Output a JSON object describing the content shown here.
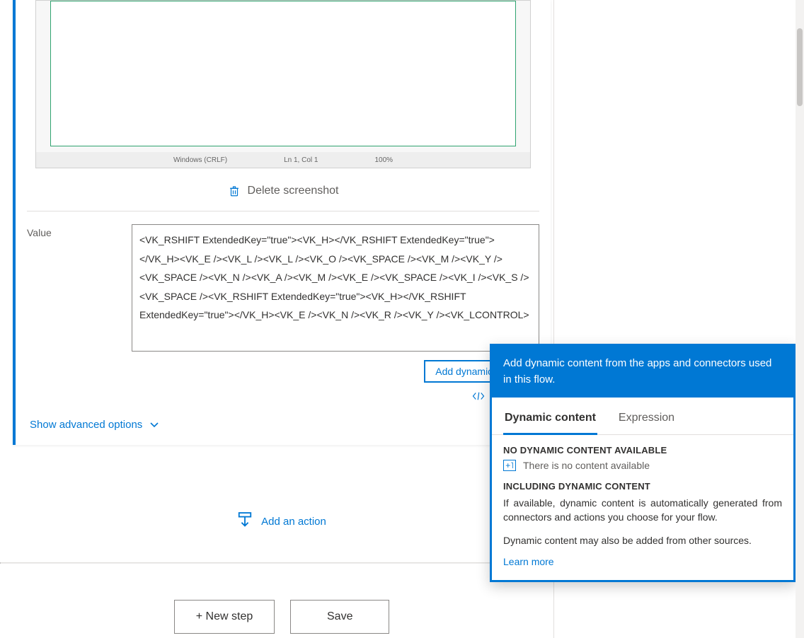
{
  "screenshot": {
    "statusbar_left": "Windows (CRLF)",
    "statusbar_mid": "Ln 1, Col 1",
    "statusbar_right": "100%"
  },
  "deleteScreenshotLabel": "Delete screenshot",
  "valueLabel": "Value",
  "valueText": "<VK_RSHIFT ExtendedKey=\"true\"><VK_H></VK_RSHIFT ExtendedKey=\"true\"></VK_H><VK_E /><VK_L /><VK_L /><VK_O /><VK_SPACE /><VK_M /><VK_Y /><VK_SPACE /><VK_N /><VK_A /><VK_M /><VK_E /><VK_SPACE /><VK_I /><VK_S /><VK_SPACE /><VK_RSHIFT ExtendedKey=\"true\"><VK_H></VK_RSHIFT ExtendedKey=\"true\"></VK_H><VK_E /><VK_N /><VK_R /><VK_Y /><VK_LCONTROL>",
  "addDynamicPill": "Add dynamic content",
  "editCodeLabel": "Edit code",
  "showAdvancedLabel": "Show advanced options",
  "addActionLabel": "Add an action",
  "footer": {
    "newStep": "+ New step",
    "save": "Save"
  },
  "popup": {
    "header": "Add dynamic content from the apps and connectors used in this flow.",
    "tabs": {
      "dynamic": "Dynamic content",
      "expression": "Expression"
    },
    "noContentTitle": "NO DYNAMIC CONTENT AVAILABLE",
    "noContentText": "There is no content available",
    "includingTitle": "INCLUDING DYNAMIC CONTENT",
    "includingText": "If available, dynamic content is automatically generated from connectors and actions you choose for your flow.",
    "otherSourcesText": "Dynamic content may also be added from other sources.",
    "learnMore": "Learn more"
  }
}
